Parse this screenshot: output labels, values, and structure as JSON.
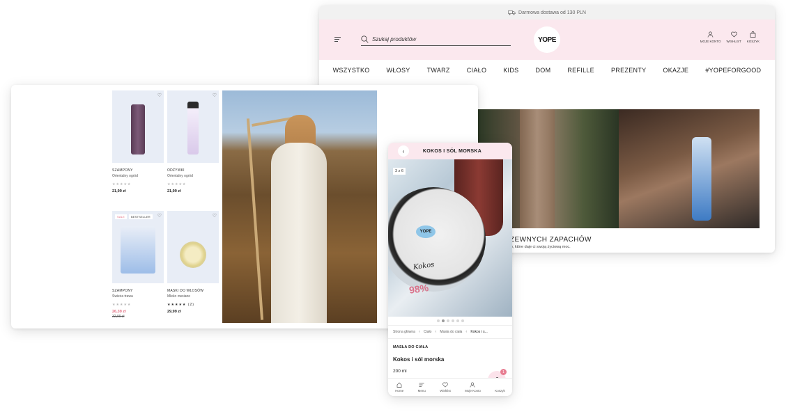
{
  "desktop": {
    "topbar": {
      "text": "Darmowa dostawa od 130 PLN",
      "icon": "truck-icon"
    },
    "search": {
      "placeholder": "Szukaj produktów"
    },
    "logo": "YOPE",
    "header_icons": [
      {
        "label": "MOJE KONTO",
        "icon": "user-icon"
      },
      {
        "label": "WISHLIST",
        "icon": "heart-icon"
      },
      {
        "label": "KOSZYK",
        "icon": "bag-icon"
      }
    ],
    "nav": [
      "WSZYSTKO",
      "WŁOSY",
      "TWARZ",
      "CIAŁO",
      "KIDS",
      "DOM",
      "REFILLE",
      "PREZENTY",
      "OKAZJE",
      "#YOPEFORGOOD"
    ],
    "banner": {
      "title": "C DRZEWNYCH ZAPACHÓW",
      "subtitle": "romatycznych drzew, które daje ci swoją życiową moc."
    }
  },
  "shop": {
    "products": [
      {
        "category": "SZAMPONY",
        "name": "Orientalny ogród",
        "rating": "★★★★★",
        "price": "21,99 zł"
      },
      {
        "category": "ODŻYWKI",
        "name": "Orientalny ogród",
        "rating": "★★★★★",
        "price": "21,99 zł"
      },
      {
        "category": "SZAMPONY",
        "name": "Świeża trawa",
        "rating": "★★★★★",
        "price": "26,39 zł",
        "old_price": "32,99 zł",
        "badges": [
          "SALE",
          "BESTSELLER"
        ]
      },
      {
        "category": "MASKI DO WŁOSÓW",
        "name": "Mleko owsiane",
        "rating": "★★★★★",
        "reviews": "(2)",
        "price": "29,99 zł"
      }
    ]
  },
  "mobile": {
    "title": "KOKOS I SÓL MORSKA",
    "pack": "3 z 6",
    "image_logo": "YOPE",
    "image_text": "Kokos",
    "image_pct": "98%",
    "dots": {
      "total": 6,
      "active": 2
    },
    "breadcrumbs": [
      "Strona główna",
      "Ciało",
      "Masła do ciała",
      "Kokos i s..."
    ],
    "category": "MASŁA DO CIAŁA",
    "name": "Kokos i sól morska",
    "volume": "200 ml",
    "tabs": [
      {
        "label": "Home",
        "icon": "home-icon"
      },
      {
        "label": "Menu",
        "icon": "menu-icon"
      },
      {
        "label": "Wishlist",
        "icon": "heart-icon"
      },
      {
        "label": "Moje Konto",
        "icon": "user-icon"
      },
      {
        "label": "Koszyk",
        "icon": "bag-icon"
      }
    ],
    "cart_count": "1",
    "colors": {
      "accent_pink": "#fbe8ee",
      "sale": "#e26a7d"
    }
  }
}
